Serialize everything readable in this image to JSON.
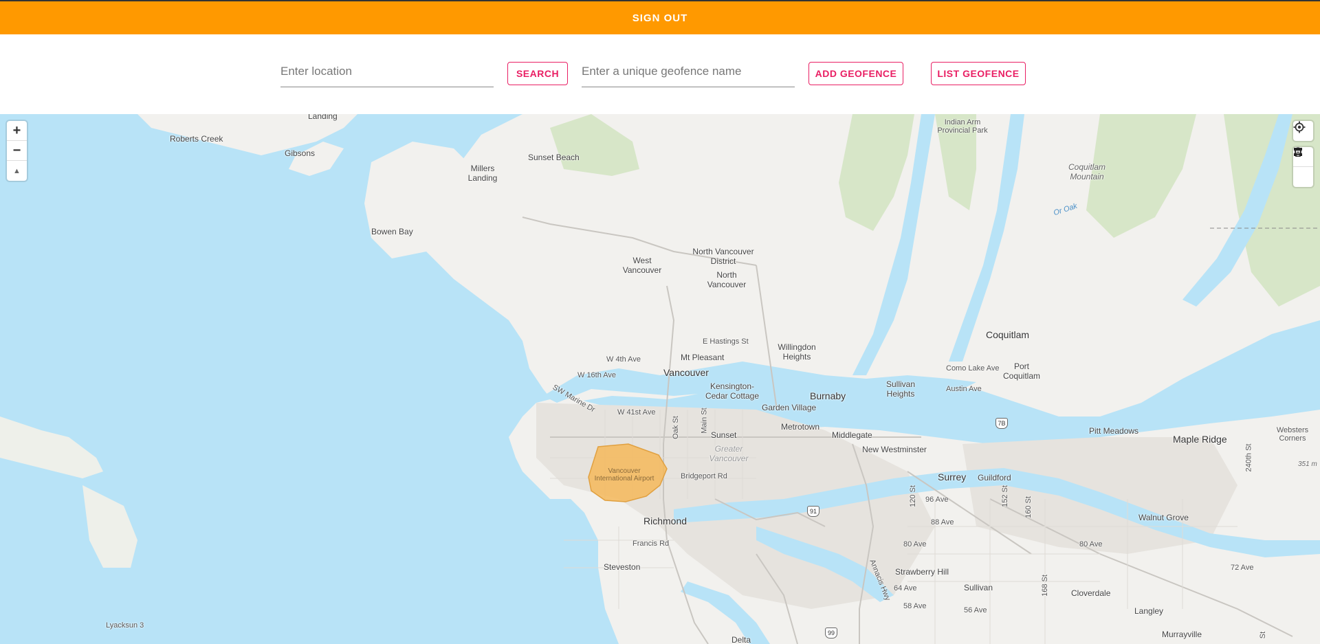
{
  "header": {
    "signout_label": "SIGN OUT"
  },
  "toolbar": {
    "location_placeholder": "Enter location",
    "location_value": "",
    "search_label": "SEARCH",
    "geofence_placeholder": "Enter a unique geofence name",
    "geofence_value": "",
    "add_geofence_label": "ADD GEOFENCE",
    "list_geofence_label": "LIST GEOFENCE"
  },
  "map": {
    "zoom_in": "+",
    "zoom_out": "−",
    "compass": "▲",
    "geofence_label": "Vancouver International Airport",
    "colors": {
      "water": "#b8e3f7",
      "land": "#f2f1ee",
      "park": "#d7e6c8",
      "urban": "#e6e3de",
      "geofence": "#f5b95a"
    },
    "places": {
      "landing": "Landing",
      "roberts_creek": "Roberts Creek",
      "gibsons": "Gibsons",
      "sunset_beach": "Sunset Beach",
      "millers_landing": "Millers Landing",
      "bowen_bay": "Bowen Bay",
      "indian_arm": "Indian Arm Provincial Park",
      "coquitlam_mountain": "Coquitlam Mountain",
      "or_oak": "Or Oak",
      "west_vancouver": "West Vancouver",
      "north_vancouver_district": "North Vancouver District",
      "north_vancouver": "North Vancouver",
      "e_hastings": "E Hastings St",
      "willingdon": "Willingdon Heights",
      "coquitlam": "Coquitlam",
      "w4th": "W 4th Ave",
      "mt_pleasant": "Mt Pleasant",
      "como_lake": "Como Lake Ave",
      "port_coquitlam": "Port Coquitlam",
      "vancouver": "Vancouver",
      "w16th": "W 16th Ave",
      "kensington": "Kensington-Cedar Cottage",
      "burnaby": "Burnaby",
      "sullivan_heights": "Sullivan Heights",
      "austin": "Austin Ave",
      "sw_marine": "SW Marine Dr",
      "garden_village": "Garden Village",
      "w41st": "W 41st Ave",
      "oak_st": "Oak St",
      "main_st": "Main St",
      "metrotown": "Metrotown",
      "pitt_meadows": "Pitt Meadows",
      "maple_ridge": "Maple Ridge",
      "websters_corners": "Websters Corners",
      "sunset": "Sunset",
      "middlegate": "Middlegate",
      "greater_vancouver": "Greater Vancouver",
      "new_westminster": "New Westminster",
      "bridgeport": "Bridgeport Rd",
      "surrey": "Surrey",
      "guildford": "Guildford",
      "ave_240": "240th St",
      "ave_351m": "351 m",
      "st_120": "120 St",
      "ave_96": "96 Ave",
      "st_152": "152 St",
      "st_160": "160 St",
      "richmond": "Richmond",
      "walnut_grove": "Walnut Grove",
      "ave_88": "88 Ave",
      "francis": "Francis Rd",
      "ave_80a": "80 Ave",
      "ave_80b": "80 Ave",
      "ave_72": "72 Ave",
      "steveston": "Steveston",
      "annacis": "Annacis Hwy",
      "strawberry_hill": "Strawberry Hill",
      "ave_64": "64 Ave",
      "sullivan": "Sullivan",
      "st_168": "168 St",
      "cloverdale": "Cloverdale",
      "ave_58": "58 Ave",
      "ave_56": "56 Ave",
      "langley": "Langley",
      "lyacksun": "Lyacksun 3",
      "murrayville": "Murrayville",
      "delta": "Delta",
      "st_5": "St"
    },
    "shields": {
      "hwy7b": "7B",
      "hwy91": "91",
      "hwy99": "99"
    }
  }
}
